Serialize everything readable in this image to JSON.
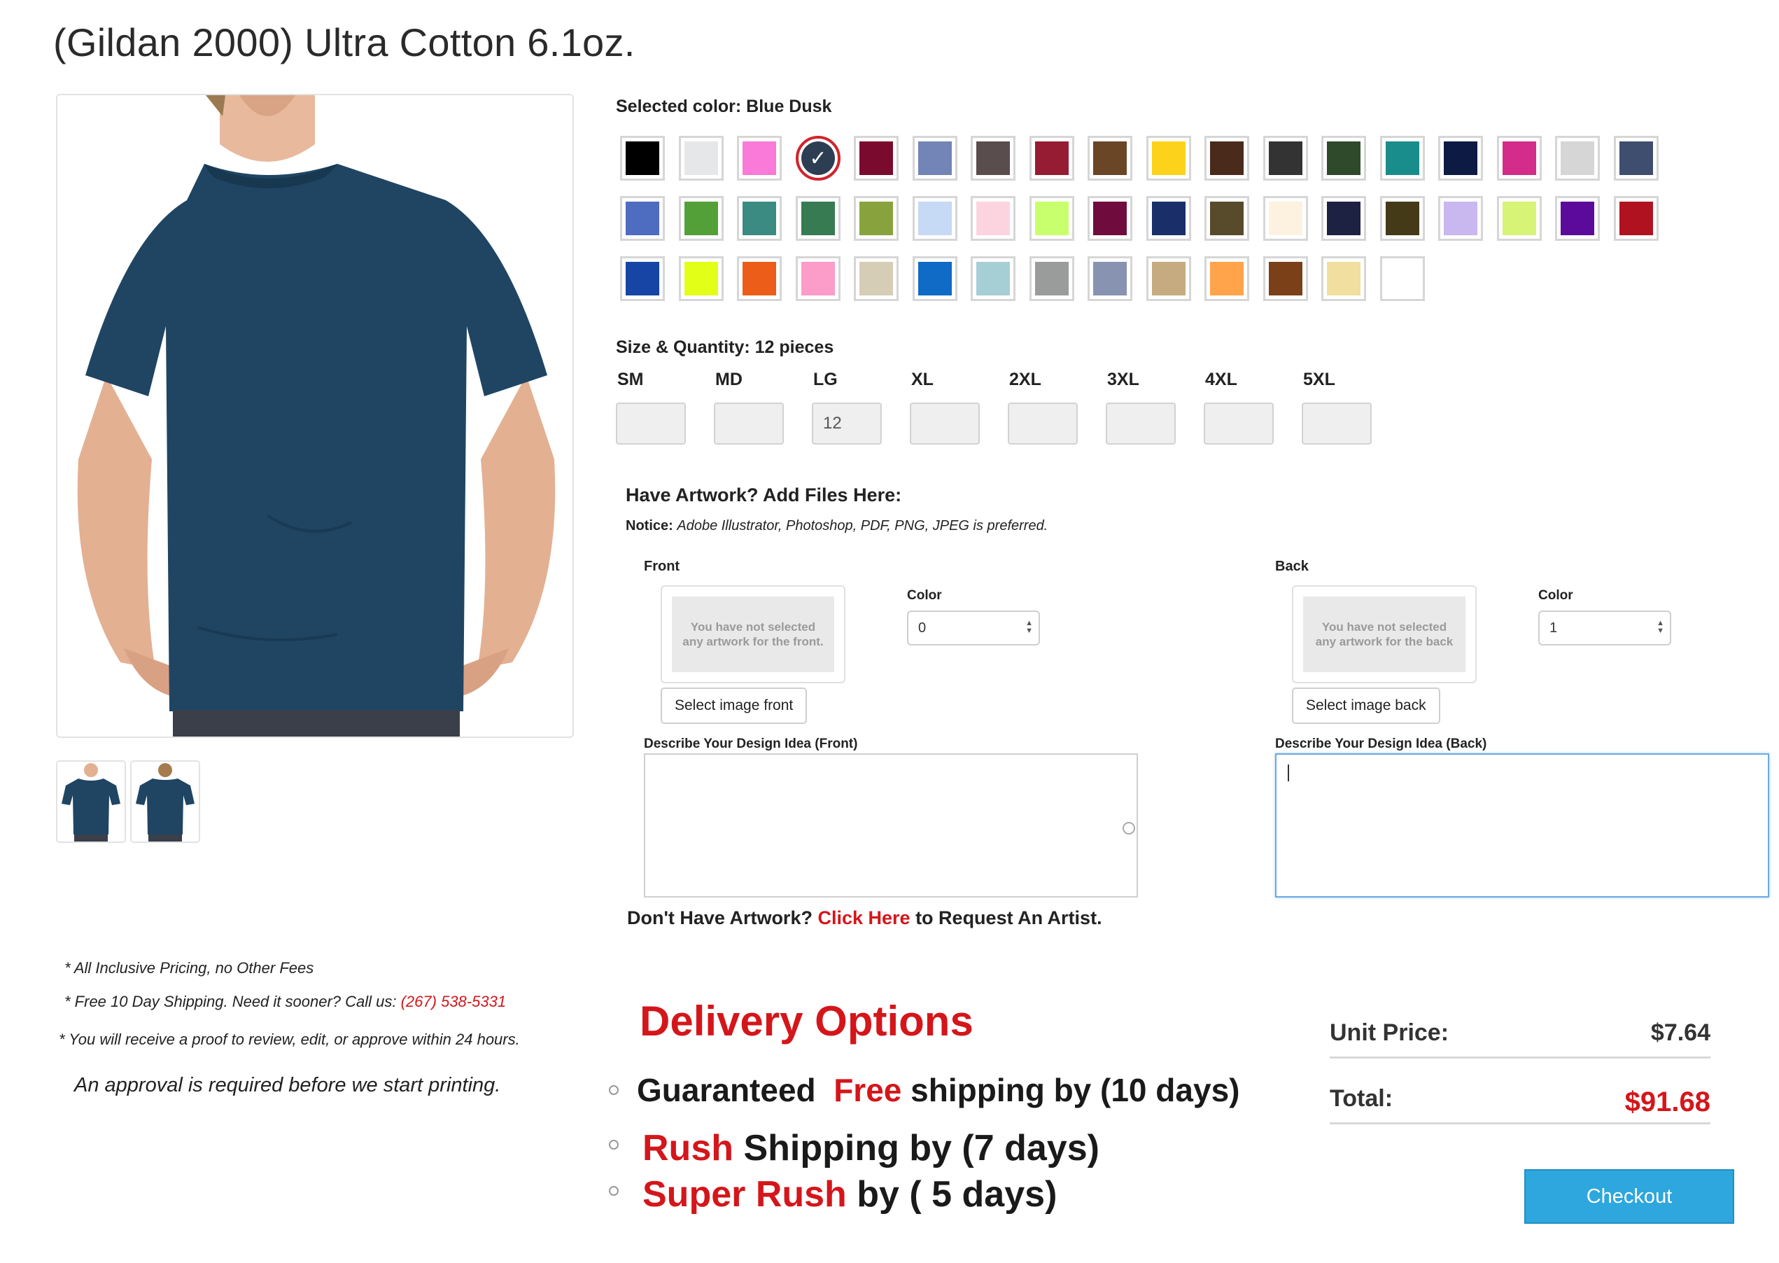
{
  "product": {
    "title": "(Gildan 2000) Ultra Cotton 6.1oz."
  },
  "colors": {
    "selected_label": "Selected color: Blue Dusk",
    "selected_index": 3,
    "check_glyph": "✓",
    "swatches": [
      "#000000",
      "#e6e7e8",
      "#f97ad8",
      "#2d3d52",
      "#7a0b2e",
      "#7385b6",
      "#5a4d4d",
      "#961c33",
      "#6a4526",
      "#fcd31a",
      "#4a2a1a",
      "#333333",
      "#2f4a2a",
      "#198c8c",
      "#0d1a44",
      "#d32c8a",
      "#d6d6d6",
      "#3f4d6e",
      "#4e6dc1",
      "#53a039",
      "#3b8b82",
      "#377b52",
      "#88a33d",
      "#c6d9f5",
      "#fcd4e0",
      "#c8ff6d",
      "#6f0b3d",
      "#1a2f6a",
      "#574b2b",
      "#fdf2e0",
      "#1d2142",
      "#453a18",
      "#c9b7ef",
      "#d8f476",
      "#5c0a9c",
      "#b0131f",
      "#1745a5",
      "#e2ff18",
      "#ec5d1a",
      "#fb9cc9",
      "#d5cdb5",
      "#0f6bc5",
      "#a6ced5",
      "#9a9c9c",
      "#8893b2",
      "#c5ab7f",
      "#ffa44b",
      "#7c4018",
      "#f1df9f",
      "#ffffff"
    ]
  },
  "sizes": {
    "title": "Size & Quantity: 12 pieces",
    "items": [
      {
        "label": "SM",
        "value": ""
      },
      {
        "label": "MD",
        "value": ""
      },
      {
        "label": "LG",
        "value": "12"
      },
      {
        "label": "XL",
        "value": ""
      },
      {
        "label": "2XL",
        "value": ""
      },
      {
        "label": "3XL",
        "value": ""
      },
      {
        "label": "4XL",
        "value": ""
      },
      {
        "label": "5XL",
        "value": ""
      }
    ]
  },
  "artwork": {
    "title": "Have Artwork? Add Files Here:",
    "notice_label": "Notice:",
    "notice_text": "Adobe Illustrator, Photoshop, PDF, PNG, JPEG is preferred.",
    "front": {
      "label": "Front",
      "placeholder": "You have not selected any artwork for the front.",
      "button": "Select image front",
      "color_label": "Color",
      "color_value": "0",
      "desc_label": "Describe Your Design Idea (Front)"
    },
    "back": {
      "label": "Back",
      "placeholder": "You have not selected any artwork for the back",
      "button": "Select image back",
      "color_label": "Color",
      "color_value": "1",
      "desc_label": "Describe Your Design Idea (Back)"
    },
    "no_art_prefix": "Don't Have Artwork?",
    "no_art_link": "Click Here",
    "no_art_suffix": "to Request An Artist."
  },
  "notes": {
    "line1": "* All Inclusive Pricing, no Other Fees",
    "line2_prefix": "* Free 10 Day Shipping. Need it sooner? Call us:",
    "line2_phone": "(267) 538-5331",
    "line3": "* You will receive a proof to review, edit, or approve within 24 hours.",
    "approval": "An approval is required before we start printing."
  },
  "delivery": {
    "title": "Delivery Options",
    "options": [
      {
        "a": "Guaranteed",
        "red": "Free",
        "b": "shipping by (10 days)"
      },
      {
        "red": "Rush",
        "b": "Shipping by (7 days)"
      },
      {
        "red": "Super Rush",
        "b": "by ( 5 days)"
      }
    ]
  },
  "pricing": {
    "unit_label": "Unit Price:",
    "unit_value": "$7.64",
    "total_label": "Total:",
    "total_value": "$91.68",
    "checkout": "Checkout"
  },
  "colors_theme": {
    "accent_red": "#d4161b",
    "checkout_blue": "#2da7de",
    "shirt": "#1f4563"
  }
}
